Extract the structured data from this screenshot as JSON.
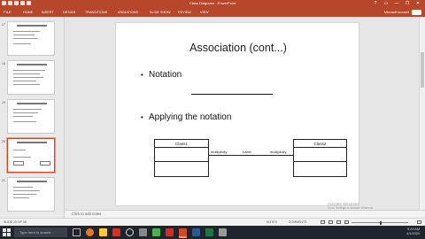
{
  "window": {
    "title": "Class Diagrams - PowerPoint"
  },
  "ribbon": {
    "file_label": "FILE",
    "tabs": [
      "HOME",
      "INSERT",
      "DESIGN",
      "TRANSITIONS",
      "ANIMATIONS",
      "SLIDE SHOW",
      "REVIEW",
      "VIEW"
    ],
    "account": "Microsoft account"
  },
  "thumbnails": [
    {
      "number": "17"
    },
    {
      "number": "18"
    },
    {
      "number": "19"
    },
    {
      "number": "20"
    },
    {
      "number": "21"
    }
  ],
  "slide": {
    "title": "Association (cont...)",
    "bullets": [
      "Notation",
      "Applying the notation"
    ],
    "diagram": {
      "left_class": "Class1",
      "right_class": "Class2",
      "left_multiplicity": "multiplicity",
      "right_multiplicity": "multiplicity",
      "association_label": "Label"
    }
  },
  "notes": {
    "placeholder": "Click to add notes"
  },
  "status": {
    "slide_info": "SLIDE 20 OF 38",
    "notes_button": "NOTES",
    "comments_button": "COMMENTS",
    "zoom": "-"
  },
  "watermark": {
    "line1": "Activate Windows",
    "line2": "Go to Settings to activate Windows."
  },
  "taskbar": {
    "search_placeholder": "Type here to search",
    "time": "5:29 AM",
    "date": "4/1/2020"
  },
  "colors": {
    "accent": "#b7472a",
    "taskbar": "#20242c"
  }
}
